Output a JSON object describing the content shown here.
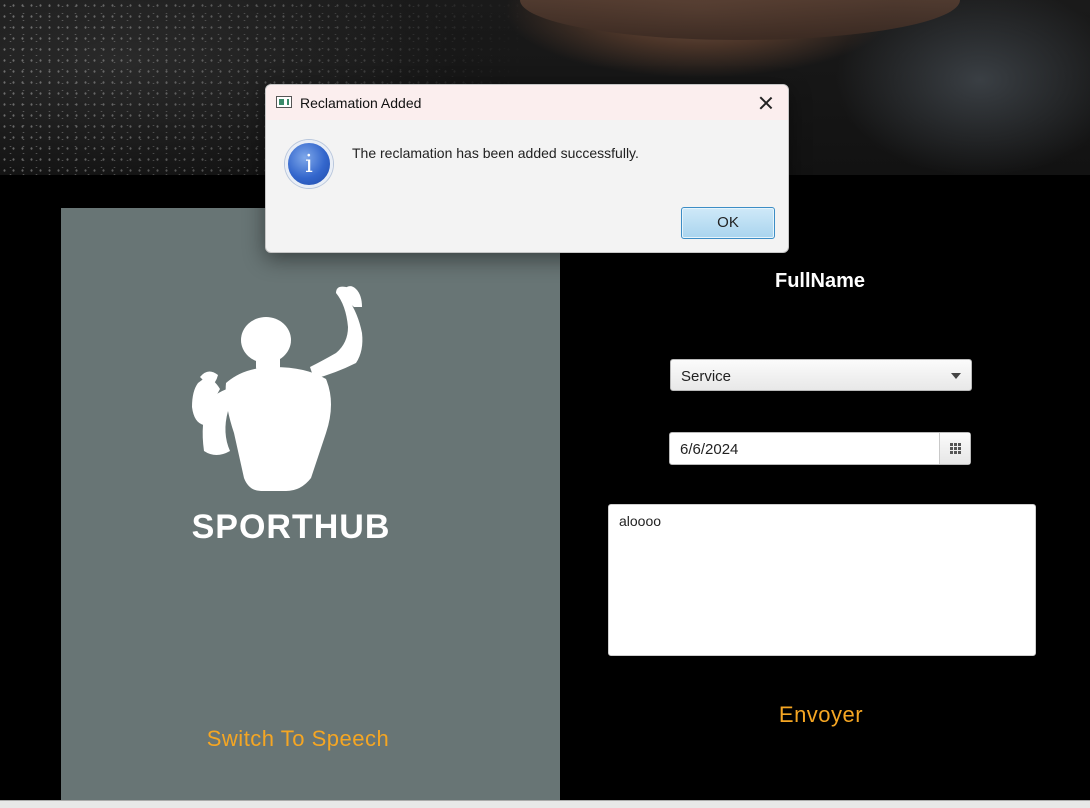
{
  "left_panel": {
    "brand": "SPORTHUB",
    "switch_label": "Switch To Speech",
    "logo_icon": "flexing-man-icon"
  },
  "form": {
    "title": "FullName",
    "service_select": {
      "value": "Service"
    },
    "date_field": {
      "value": "6/6/2024",
      "icon": "calendar-icon"
    },
    "message_textarea": {
      "value": "aloooo"
    },
    "submit_label": "Envoyer"
  },
  "dialog": {
    "title": "Reclamation Added",
    "message": "The reclamation has been added successfully.",
    "ok_label": "OK",
    "icon": "info-icon"
  },
  "colors": {
    "accent": "#f5a623",
    "panel": "#687575",
    "background": "#000000"
  }
}
